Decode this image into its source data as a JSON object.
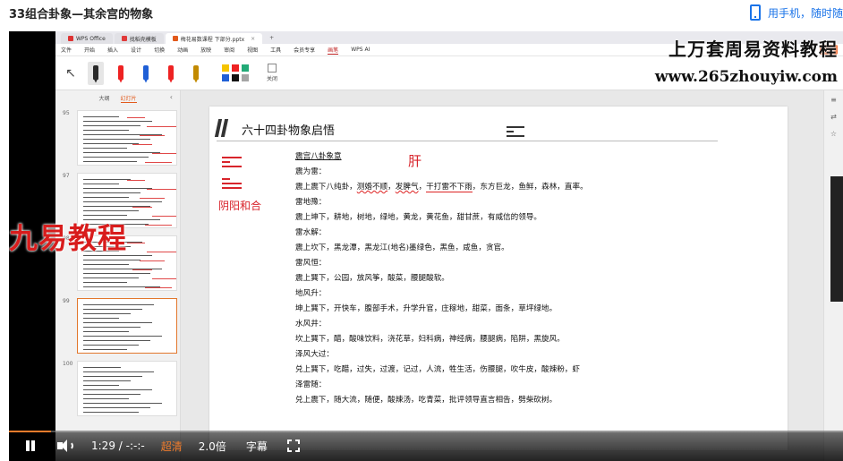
{
  "header": {
    "title": "33组合卦象—其余宫的物象",
    "mobile_link": "用手机，随时随"
  },
  "wps": {
    "tabs": [
      {
        "label": "WPS Office"
      },
      {
        "label": "找稻壳模板"
      },
      {
        "label": "梅花易数课程 下部分.pptx"
      }
    ],
    "menu": [
      "文件",
      "开始",
      "插入",
      "设计",
      "切换",
      "动画",
      "放映",
      "审阅",
      "视图",
      "工具",
      "会员专享",
      "画笔",
      "WPS AI"
    ],
    "active_menu": "画笔",
    "share_label": "分享",
    "close_tool_label": "关闭",
    "swatch_colors": [
      "#f5c400",
      "#e22",
      "#2a7",
      "#1f5fd6",
      "#111",
      "#a5a5a5"
    ],
    "pen_colors": [
      "#2a2a2a",
      "#e22",
      "#1f5fd6",
      "#e22",
      "#c28a00"
    ]
  },
  "sidebar": {
    "tab_outline": "大纲",
    "tab_slides": "幻灯片",
    "thumbs": [
      {
        "num": "95"
      },
      {
        "num": "97"
      },
      {
        "num": "98"
      },
      {
        "num": "99"
      },
      {
        "num": "100"
      }
    ]
  },
  "watermarks": {
    "left": "九易教程",
    "right_top": "上万套周易资料教程",
    "right_url": "www.265zhouyiw.com"
  },
  "slide": {
    "heading": "六十四卦物象启悟",
    "annotations": {
      "gua_name": "阴阳和合",
      "note": "肝"
    },
    "lines": [
      {
        "type": "title",
        "text": "震宫八卦象意"
      },
      {
        "type": "sub",
        "text": "震为雷："
      },
      {
        "type": "body",
        "parts": [
          "震上震下八纯卦，",
          "测婚不顺",
          "，",
          "发脾气",
          "，",
          "干打雷不下雨",
          "，东方巨龙，鱼鲜，森林，直率。"
        ]
      },
      {
        "type": "sub",
        "text": "雷地豫："
      },
      {
        "type": "body",
        "parts": [
          "震上坤下，耕地，树地，绿地，黄龙，黄花鱼，甜甘蔗，有威信的领导。"
        ]
      },
      {
        "type": "sub",
        "text": "雷水解："
      },
      {
        "type": "body",
        "parts": [
          "震上坎下，黑龙潭，黑龙江(地名)墨绿色，黑鱼，咸鱼，贪官。"
        ]
      },
      {
        "type": "sub",
        "text": "雷风恒："
      },
      {
        "type": "body",
        "parts": [
          "震上巽下，公园，放风筝，酸菜，腰腿酸软。"
        ]
      },
      {
        "type": "sub",
        "text": "地风升："
      },
      {
        "type": "body",
        "parts": [
          "坤上巽下，开快车，腹部手术，升学升官，庄稼地，甜菜，面条，草坪绿地。"
        ]
      },
      {
        "type": "sub",
        "text": "水风井："
      },
      {
        "type": "body",
        "parts": [
          "坎上巽下，醋，酸味饮料，浇花草，妇科病，神经病，腰腿病，陷阱，黑旋风。"
        ]
      },
      {
        "type": "sub",
        "text": "泽风大过："
      },
      {
        "type": "body",
        "parts": [
          "兑上巽下，吃醋，过失，过渡，记过，人流，牲生活，伤腰腿，吹牛皮，酸辣粉，虾"
        ]
      },
      {
        "type": "sub",
        "text": "泽雷随："
      },
      {
        "type": "body",
        "parts": [
          "兑上震下，随大流，随便，酸辣汤，吃青菜，批评领导直言相告，劈柴砍树。"
        ]
      }
    ]
  },
  "controls": {
    "time": "1:29 / -:-:-",
    "quality": "超清",
    "speed": "2.0倍",
    "subtitles": "字幕",
    "progress_fraction": 0.05,
    "accent": "#f07c2c"
  }
}
